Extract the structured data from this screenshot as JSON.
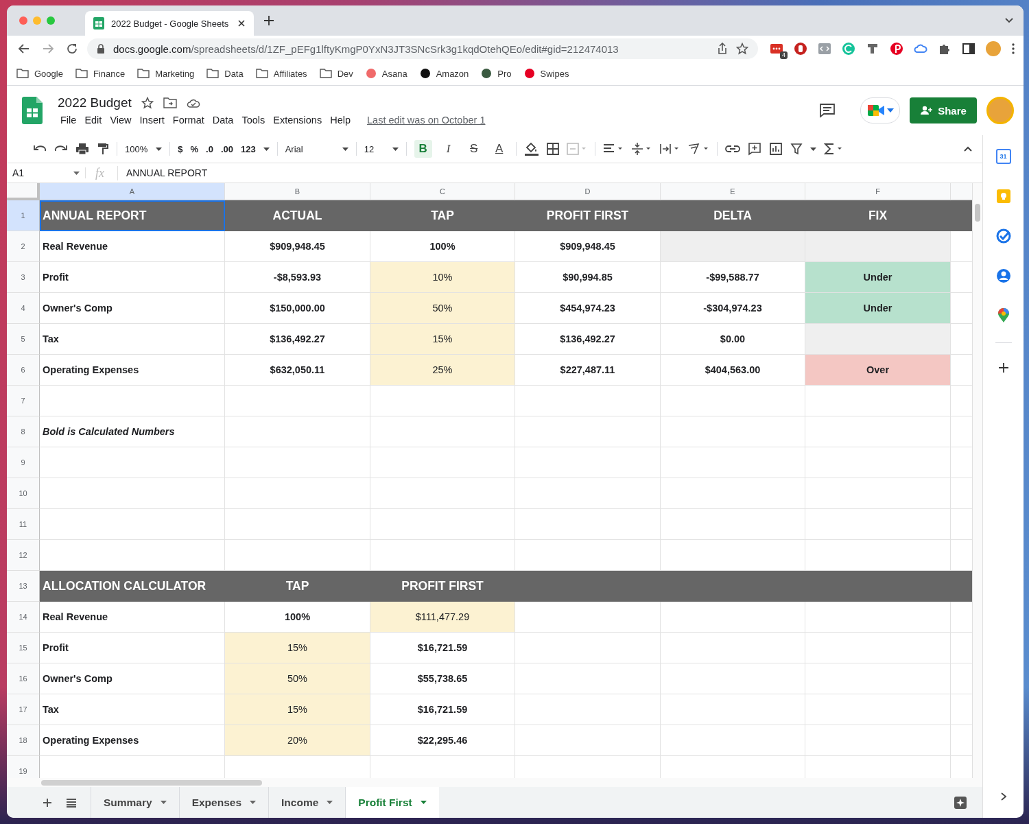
{
  "browser": {
    "tab_title": "2022 Budget - Google Sheets",
    "url_host": "docs.google.com",
    "url_path": "/spreadsheets/d/1ZF_pEFg1lftyKmgP0YxN3JT3SNcSrk3g1kqdOtehQEo/edit#gid=212474013",
    "extension_badge": "4",
    "bookmarks": [
      {
        "label": "Google",
        "kind": "folder"
      },
      {
        "label": "Finance",
        "kind": "folder"
      },
      {
        "label": "Marketing",
        "kind": "folder"
      },
      {
        "label": "Data",
        "kind": "folder"
      },
      {
        "label": "Affiliates",
        "kind": "folder"
      },
      {
        "label": "Dev",
        "kind": "folder"
      },
      {
        "label": "Asana",
        "kind": "site",
        "color": "#f06a6a"
      },
      {
        "label": "Amazon",
        "kind": "site",
        "color": "#111111"
      },
      {
        "label": "Pro",
        "kind": "site",
        "color": "#3a5a40"
      },
      {
        "label": "Swipes",
        "kind": "site",
        "color": "#e60023"
      }
    ]
  },
  "document": {
    "title": "2022 Budget",
    "menus": [
      "File",
      "Edit",
      "View",
      "Insert",
      "Format",
      "Data",
      "Tools",
      "Extensions",
      "Help"
    ],
    "last_edit": "Last edit was on October 1",
    "share": "Share"
  },
  "toolbar": {
    "zoom": "100%",
    "number_formats": [
      "$",
      "%",
      ".0",
      ".00",
      "123"
    ],
    "font": "Arial",
    "font_size": "12",
    "text_styles": [
      {
        "label": "B",
        "kind": "bold",
        "selected": true
      },
      {
        "label": "I",
        "kind": "italic",
        "selected": false
      },
      {
        "label": "S",
        "kind": "strike",
        "selected": false
      },
      {
        "label": "A",
        "kind": "color",
        "selected": false
      }
    ]
  },
  "formula_bar": {
    "cell_ref": "A1",
    "fx": "fx",
    "content": "ANNUAL REPORT"
  },
  "columns": [
    {
      "label": "A",
      "selected": true
    },
    {
      "label": "B",
      "selected": false
    },
    {
      "label": "C",
      "selected": false
    },
    {
      "label": "D",
      "selected": false
    },
    {
      "label": "E",
      "selected": false
    },
    {
      "label": "F",
      "selected": false
    }
  ],
  "rows": [
    {
      "number": "1",
      "kind": "header",
      "selected": true,
      "cells": [
        {
          "text": "ANNUAL REPORT",
          "kind": "title",
          "selected": true
        },
        {
          "text": "ACTUAL",
          "kind": "heading",
          "selected": false
        },
        {
          "text": "TAP",
          "kind": "heading",
          "selected": false
        },
        {
          "text": "PROFIT FIRST",
          "kind": "heading",
          "selected": false
        },
        {
          "text": "DELTA",
          "kind": "heading",
          "selected": false
        },
        {
          "text": "FIX",
          "kind": "heading",
          "selected": false
        }
      ]
    },
    {
      "number": "2",
      "kind": "data",
      "selected": false,
      "cells": [
        {
          "text": "Real Revenue",
          "kind": "label",
          "selected": false
        },
        {
          "text": "$909,948.45",
          "kind": "bold",
          "selected": false
        },
        {
          "text": "100%",
          "kind": "bold",
          "selected": false
        },
        {
          "text": "$909,948.45",
          "kind": "bold",
          "selected": false
        },
        {
          "kind": "empty",
          "color": "#efefef",
          "selected": false
        },
        {
          "kind": "empty",
          "color": "#efefef",
          "selected": false
        }
      ]
    },
    {
      "number": "3",
      "kind": "data",
      "selected": false,
      "cells": [
        {
          "text": "Profit",
          "kind": "label",
          "selected": false
        },
        {
          "text": "-$8,593.93",
          "kind": "bold",
          "selected": false
        },
        {
          "text": "10%",
          "kind": "plain",
          "color": "#fcf2d2",
          "selected": false
        },
        {
          "text": "$90,994.85",
          "kind": "bold",
          "selected": false
        },
        {
          "text": "-$99,588.77",
          "kind": "bold",
          "selected": false
        },
        {
          "text": "Under",
          "kind": "bold",
          "color": "#b7e1cd",
          "selected": false
        }
      ]
    },
    {
      "number": "4",
      "kind": "data",
      "selected": false,
      "cells": [
        {
          "text": "Owner's Comp",
          "kind": "label",
          "selected": false
        },
        {
          "text": "$150,000.00",
          "kind": "bold",
          "selected": false
        },
        {
          "text": "50%",
          "kind": "plain",
          "color": "#fcf2d2",
          "selected": false
        },
        {
          "text": "$454,974.23",
          "kind": "bold",
          "selected": false
        },
        {
          "text": "-$304,974.23",
          "kind": "bold",
          "selected": false
        },
        {
          "text": "Under",
          "kind": "bold",
          "color": "#b7e1cd",
          "selected": false
        }
      ]
    },
    {
      "number": "5",
      "kind": "data",
      "selected": false,
      "cells": [
        {
          "text": "Tax",
          "kind": "label",
          "selected": false
        },
        {
          "text": "$136,492.27",
          "kind": "bold",
          "selected": false
        },
        {
          "text": "15%",
          "kind": "plain",
          "color": "#fcf2d2",
          "selected": false
        },
        {
          "text": "$136,492.27",
          "kind": "bold",
          "selected": false
        },
        {
          "text": "$0.00",
          "kind": "bold",
          "selected": false
        },
        {
          "kind": "empty",
          "color": "#efefef",
          "selected": false
        }
      ]
    },
    {
      "number": "6",
      "kind": "data",
      "selected": false,
      "cells": [
        {
          "text": "Operating Expenses",
          "kind": "label",
          "selected": false
        },
        {
          "text": "$632,050.11",
          "kind": "bold",
          "selected": false
        },
        {
          "text": "25%",
          "kind": "plain",
          "color": "#fcf2d2",
          "selected": false
        },
        {
          "text": "$227,487.11",
          "kind": "bold",
          "selected": false
        },
        {
          "text": "$404,563.00",
          "kind": "bold",
          "selected": false
        },
        {
          "text": "Over",
          "kind": "bold",
          "color": "#f4c7c3",
          "selected": false
        }
      ]
    },
    {
      "number": "7",
      "kind": "data",
      "selected": false,
      "cells": []
    },
    {
      "number": "8",
      "kind": "data",
      "selected": false,
      "cells": [
        {
          "text": "Bold is Calculated Numbers",
          "kind": "note",
          "selected": false
        }
      ]
    },
    {
      "number": "9",
      "kind": "data",
      "selected": false,
      "cells": []
    },
    {
      "number": "10",
      "kind": "data",
      "selected": false,
      "cells": []
    },
    {
      "number": "11",
      "kind": "data",
      "selected": false,
      "cells": []
    },
    {
      "number": "12",
      "kind": "data",
      "selected": false,
      "cells": []
    },
    {
      "number": "13",
      "kind": "header",
      "selected": false,
      "cells": [
        {
          "text": "ALLOCATION CALCULATOR",
          "kind": "title",
          "selected": false
        },
        {
          "text": "TAP",
          "kind": "heading",
          "selected": false
        },
        {
          "text": "PROFIT FIRST",
          "kind": "heading",
          "selected": false
        }
      ]
    },
    {
      "number": "14",
      "kind": "data",
      "selected": false,
      "cells": [
        {
          "text": "Real Revenue",
          "kind": "label",
          "selected": false
        },
        {
          "text": "100%",
          "kind": "bold",
          "selected": false
        },
        {
          "text": "$111,477.29",
          "kind": "plain",
          "color": "#fcf2d2",
          "selected": false
        }
      ]
    },
    {
      "number": "15",
      "kind": "data",
      "selected": false,
      "cells": [
        {
          "text": "Profit",
          "kind": "label",
          "selected": false
        },
        {
          "text": "15%",
          "kind": "plain",
          "color": "#fcf2d2",
          "selected": false
        },
        {
          "text": "$16,721.59",
          "kind": "bold",
          "selected": false
        }
      ]
    },
    {
      "number": "16",
      "kind": "data",
      "selected": false,
      "cells": [
        {
          "text": "Owner's Comp",
          "kind": "label",
          "selected": false
        },
        {
          "text": "50%",
          "kind": "plain",
          "color": "#fcf2d2",
          "selected": false
        },
        {
          "text": "$55,738.65",
          "kind": "bold",
          "selected": false
        }
      ]
    },
    {
      "number": "17",
      "kind": "data",
      "selected": false,
      "cells": [
        {
          "text": "Tax",
          "kind": "label",
          "selected": false
        },
        {
          "text": "15%",
          "kind": "plain",
          "color": "#fcf2d2",
          "selected": false
        },
        {
          "text": "$16,721.59",
          "kind": "bold",
          "selected": false
        }
      ]
    },
    {
      "number": "18",
      "kind": "data",
      "selected": false,
      "cells": [
        {
          "text": "Operating Expenses",
          "kind": "label",
          "selected": false
        },
        {
          "text": "20%",
          "kind": "plain",
          "color": "#fcf2d2",
          "selected": false
        },
        {
          "text": "$22,295.46",
          "kind": "bold",
          "selected": false
        }
      ]
    },
    {
      "number": "19",
      "kind": "data",
      "selected": false,
      "cells": []
    }
  ],
  "sheet_tabs": [
    {
      "label": "Summary",
      "selected": false
    },
    {
      "label": "Expenses",
      "selected": false
    },
    {
      "label": "Income",
      "selected": false
    },
    {
      "label": "Profit First",
      "selected": true
    }
  ],
  "side_panel": {
    "calendar_day": "31"
  }
}
